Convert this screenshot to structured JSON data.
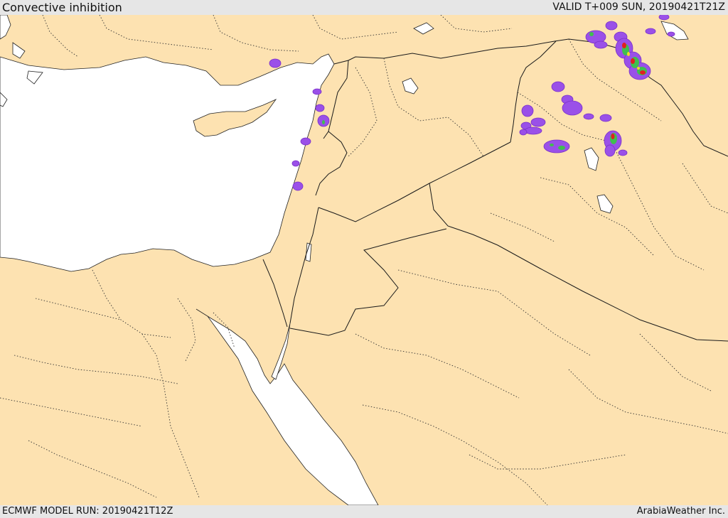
{
  "header": {
    "title": "Convective inhibition",
    "valid": "VALID T+009 SUN, 20190421T21Z"
  },
  "footer": {
    "model_run": "ECMWF MODEL RUN: 20190421T12Z",
    "credit": "ArabiaWeather Inc."
  },
  "colors": {
    "land": "#fde2b1",
    "water": "#ffffff",
    "border": "#1a1a1a",
    "low": "#9a50e8",
    "mid": "#3fbf4f",
    "high": "#e02020",
    "peak": "#f0e020"
  }
}
